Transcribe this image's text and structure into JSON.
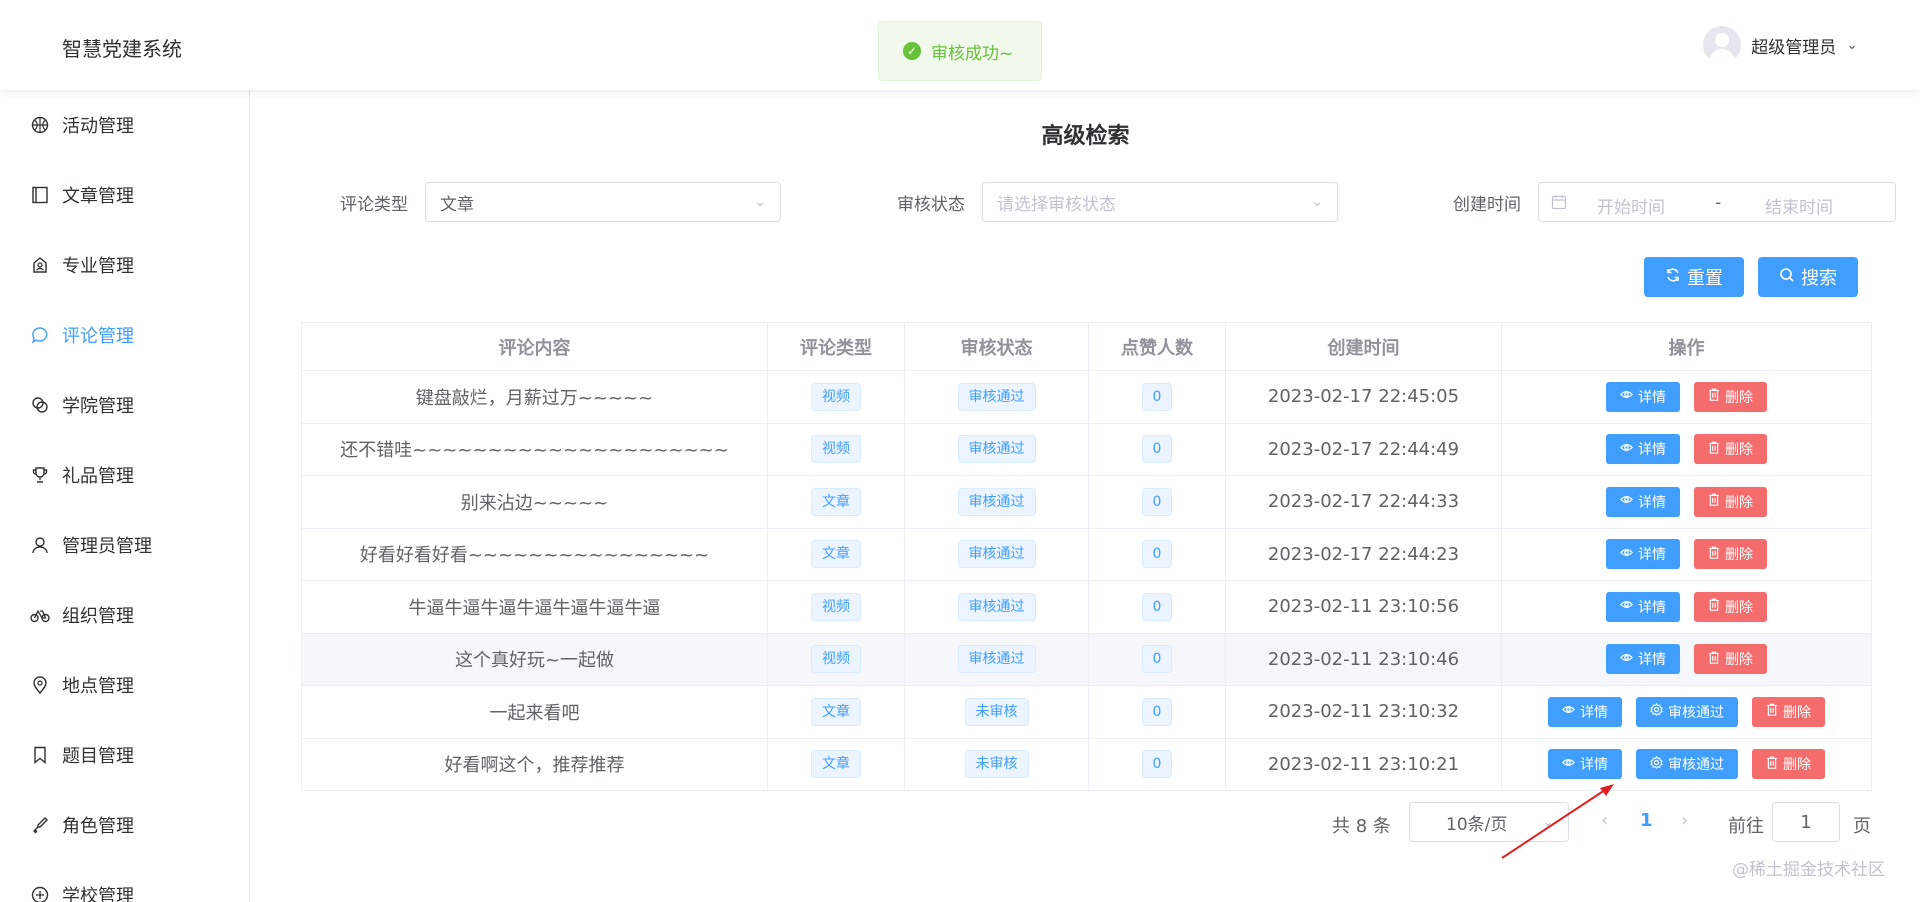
{
  "header": {
    "app_title": "智慧党建系统",
    "user_name": "超级管理员"
  },
  "toast": {
    "message": "审核成功~"
  },
  "sidebar": {
    "items": [
      {
        "label": "活动管理",
        "icon": "basketball-icon"
      },
      {
        "label": "文章管理",
        "icon": "notebook-icon"
      },
      {
        "label": "专业管理",
        "icon": "school-bag-icon"
      },
      {
        "label": "评论管理",
        "icon": "chat-bubble-icon",
        "active": true
      },
      {
        "label": "学院管理",
        "icon": "link-icon"
      },
      {
        "label": "礼品管理",
        "icon": "trophy-icon"
      },
      {
        "label": "管理员管理",
        "icon": "user-icon"
      },
      {
        "label": "组织管理",
        "icon": "bicycle-icon"
      },
      {
        "label": "地点管理",
        "icon": "location-icon"
      },
      {
        "label": "题目管理",
        "icon": "bookmark-icon"
      },
      {
        "label": "角色管理",
        "icon": "key-icon"
      },
      {
        "label": "学校管理",
        "icon": "school-icon"
      }
    ]
  },
  "search": {
    "title": "高级检索",
    "type_label": "评论类型",
    "type_value": "文章",
    "status_label": "审核状态",
    "status_placeholder": "请选择审核状态",
    "date_label": "创建时间",
    "start_placeholder": "开始时间",
    "date_separator": "-",
    "end_placeholder": "结束时间",
    "reset_label": "重置",
    "search_label": "搜索"
  },
  "table": {
    "headers": [
      "评论内容",
      "评论类型",
      "审核状态",
      "点赞人数",
      "创建时间",
      "操作"
    ],
    "rows": [
      {
        "content": "键盘敲烂，月薪过万~~~~~",
        "type": "视频",
        "status": "审核通过",
        "likes": "0",
        "created": "2023-02-17 22:45:05"
      },
      {
        "content": "还不错哇~~~~~~~~~~~~~~~~~~~~~",
        "type": "视频",
        "status": "审核通过",
        "likes": "0",
        "created": "2023-02-17 22:44:49"
      },
      {
        "content": "别来沾边~~~~~",
        "type": "文章",
        "status": "审核通过",
        "likes": "0",
        "created": "2023-02-17 22:44:33"
      },
      {
        "content": "好看好看好看~~~~~~~~~~~~~~~~",
        "type": "文章",
        "status": "审核通过",
        "likes": "0",
        "created": "2023-02-17 22:44:23"
      },
      {
        "content": "牛逼牛逼牛逼牛逼牛逼牛逼牛逼",
        "type": "视频",
        "status": "审核通过",
        "likes": "0",
        "created": "2023-02-11 23:10:56"
      },
      {
        "content": "这个真好玩~一起做",
        "type": "视频",
        "status": "审核通过",
        "likes": "0",
        "created": "2023-02-11 23:10:46"
      },
      {
        "content": "一起来看吧",
        "type": "文章",
        "status": "未审核",
        "likes": "0",
        "created": "2023-02-11 23:10:32"
      },
      {
        "content": "好看啊这个，推荐推荐",
        "type": "文章",
        "status": "未审核",
        "likes": "0",
        "created": "2023-02-11 23:10:21"
      }
    ],
    "actions": {
      "detail": "详情",
      "approve": "审核通过",
      "delete": "删除"
    }
  },
  "pagination": {
    "total_text": "共 8 条",
    "page_size": "10条/页",
    "current_page": "1",
    "goto_label": "前往",
    "goto_value": "1",
    "page_suffix": "页"
  },
  "watermark": "@稀土掘金技术社区",
  "colors": {
    "primary": "#409eff",
    "danger": "#f56c6c",
    "success": "#67c23a"
  }
}
